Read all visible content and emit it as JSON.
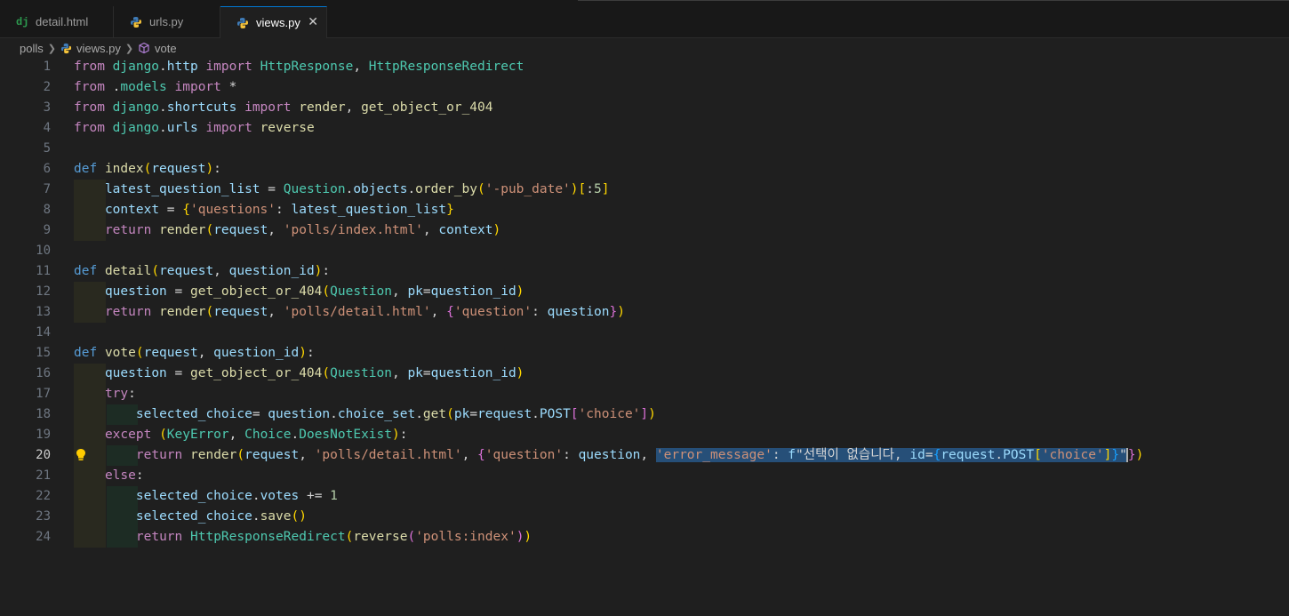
{
  "tabs": [
    {
      "label": "detail.html",
      "icon": "django-icon",
      "active": false
    },
    {
      "label": "urls.py",
      "icon": "python-icon",
      "active": false
    },
    {
      "label": "views.py",
      "icon": "python-icon",
      "active": true
    }
  ],
  "breadcrumb": {
    "folder": "polls",
    "file": "views.py",
    "symbol": "vote"
  },
  "editor": {
    "current_line": 20,
    "lines": [
      "from django.http import HttpResponse, HttpResponseRedirect",
      "from .models import *",
      "from django.shortcuts import render, get_object_or_404",
      "from django.urls import reverse",
      "",
      "def index(request):",
      "    latest_question_list = Question.objects.order_by('-pub_date')[:5]",
      "    context = {'questions': latest_question_list}",
      "    return render(request, 'polls/index.html', context)",
      "",
      "def detail(request, question_id):",
      "    question = get_object_or_404(Question, pk=question_id)",
      "    return render(request, 'polls/detail.html', {'question': question})",
      "",
      "def vote(request, question_id):",
      "    question = get_object_or_404(Question, pk=question_id)",
      "    try:",
      "        selected_choice= question.choice_set.get(pk=request.POST['choice'])",
      "    except (KeyError, Choice.DoesNotExist):",
      "        return render(request, 'polls/detail.html', {'question': question, 'error_message': f\"선택이 없습니다, id={request.POST['choice']}\"})",
      "    else:",
      "        selected_choice.votes += 1",
      "        selected_choice.save()",
      "        return HttpResponseRedirect(reverse('polls:index'))"
    ]
  }
}
